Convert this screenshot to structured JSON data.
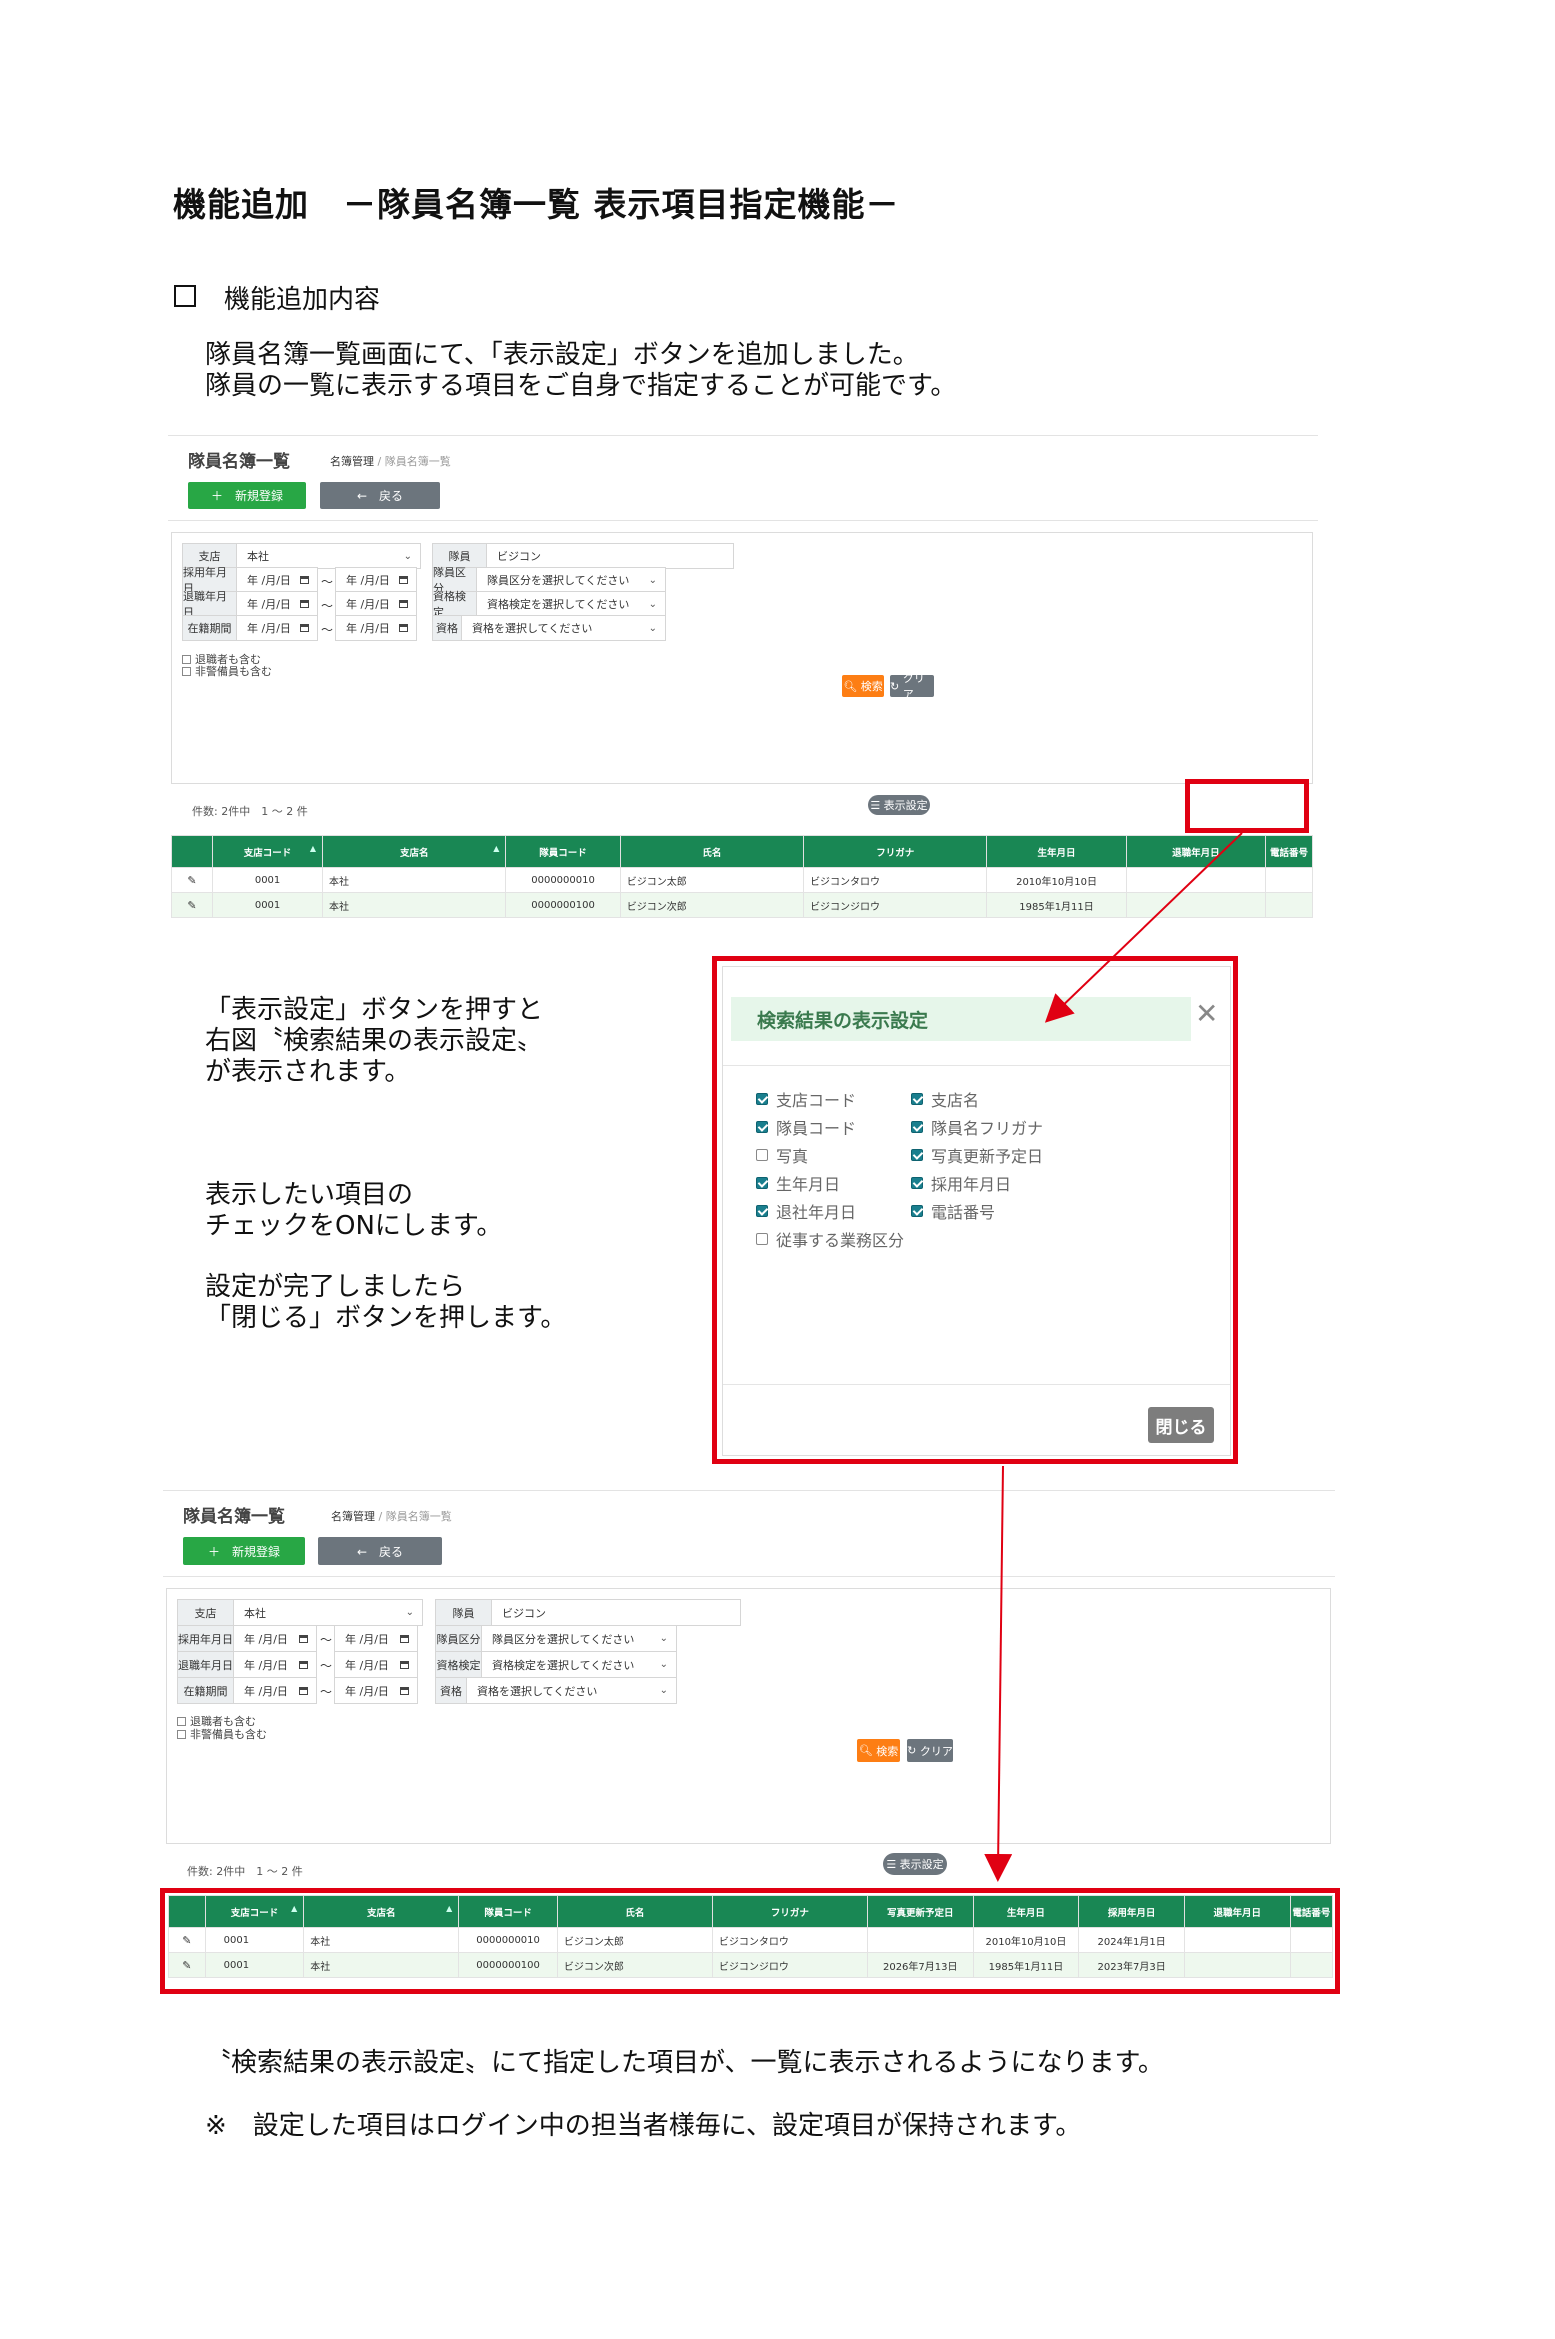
{
  "doc": {
    "title": "機能追加　－隊員名簿一覧 表示項目指定機能－",
    "section_title": "機能追加内容",
    "intro_lines": [
      "隊員名簿一覧画面にて、「表示設定」ボタンを追加しました。",
      "隊員の一覧に表示する項目をご自身で指定することが可能です。"
    ],
    "explain1_lines": [
      "「表示設定」ボタンを押すと",
      "右図〝検索結果の表示設定〟",
      "が表示されます。"
    ],
    "explain2_lines": [
      "表示したい項目の",
      "チェックをONにします。"
    ],
    "explain3_lines": [
      "設定が完了しましたら",
      "「閉じる」ボタンを押します。"
    ],
    "footer_line1": "〝検索結果の表示設定〟にて指定した項目が、一覧に表示されるようになります。",
    "footer_line2": "※　設定した項目はログイン中の担当者様毎に、設定項目が保持されます。"
  },
  "screen": {
    "page_title": "隊員名簿一覧",
    "breadcrumb_parent": "名簿管理",
    "breadcrumb_sep": " / ",
    "breadcrumb_current": "隊員名簿一覧",
    "new_button": "＋　新規登録",
    "back_button": "←　戻る",
    "labels": {
      "branch": "支店",
      "member": "隊員",
      "hire_date": "採用年月日",
      "member_type": "隊員区分",
      "retire_date": "退職年月日",
      "cert_exam": "資格検定",
      "tenure": "在籍期間",
      "cert": "資格"
    },
    "values": {
      "branch": "本社",
      "member": "ビジコン",
      "date_placeholder": "年 /月/日",
      "tilde": "～",
      "member_type": "隊員区分を選択してください",
      "cert_exam": "資格検定を選択してください",
      "cert": "資格を選択してください"
    },
    "checks": [
      "退職者も含む",
      "非警備員も含む"
    ],
    "search_button": "検索",
    "clear_button": "クリア",
    "display_settings_button": "表示設定",
    "count_text": "件数: 2件中　1 ～ 2 件",
    "table1": {
      "headers": [
        "",
        "支店コード",
        "支店名",
        "隊員コード",
        "氏名",
        "フリガナ",
        "生年月日",
        "退職年月日",
        "電話番号"
      ],
      "rows": [
        [
          "0001",
          "本社",
          "0000000010",
          "ビジコン太郎",
          "ビジコンタロウ",
          "2010年10月10日",
          "",
          ""
        ],
        [
          "0001",
          "本社",
          "0000000100",
          "ビジコン次郎",
          "ビジコンジロウ",
          "1985年1月11日",
          "",
          ""
        ]
      ]
    },
    "table2": {
      "headers": [
        "",
        "支店コード",
        "支店名",
        "隊員コード",
        "氏名",
        "フリガナ",
        "写真更新予定日",
        "生年月日",
        "採用年月日",
        "退職年月日",
        "電話番号"
      ],
      "rows": [
        [
          "0001",
          "本社",
          "0000000010",
          "ビジコン太郎",
          "ビジコンタロウ",
          "",
          "2010年10月10日",
          "2024年1月1日",
          "",
          ""
        ],
        [
          "0001",
          "本社",
          "0000000100",
          "ビジコン次郎",
          "ビジコンジロウ",
          "2026年7月13日",
          "1985年1月11日",
          "2023年7月3日",
          "",
          ""
        ]
      ]
    }
  },
  "modal": {
    "title": "検索結果の表示設定",
    "close_button": "閉じる",
    "options_left": [
      {
        "label": "支店コード",
        "checked": true
      },
      {
        "label": "隊員コード",
        "checked": true
      },
      {
        "label": "写真",
        "checked": false
      },
      {
        "label": "生年月日",
        "checked": true
      },
      {
        "label": "退社年月日",
        "checked": true
      },
      {
        "label": "従事する業務区分",
        "checked": false
      }
    ],
    "options_right": [
      {
        "label": "支店名",
        "checked": true
      },
      {
        "label": "隊員名フリガナ",
        "checked": true
      },
      {
        "label": "写真更新予定日",
        "checked": true
      },
      {
        "label": "採用年月日",
        "checked": true
      },
      {
        "label": "電話番号",
        "checked": true
      }
    ]
  },
  "colors": {
    "green": "#198754",
    "red": "#e00012",
    "orange": "#fd7e14",
    "gray": "#6c757d"
  }
}
